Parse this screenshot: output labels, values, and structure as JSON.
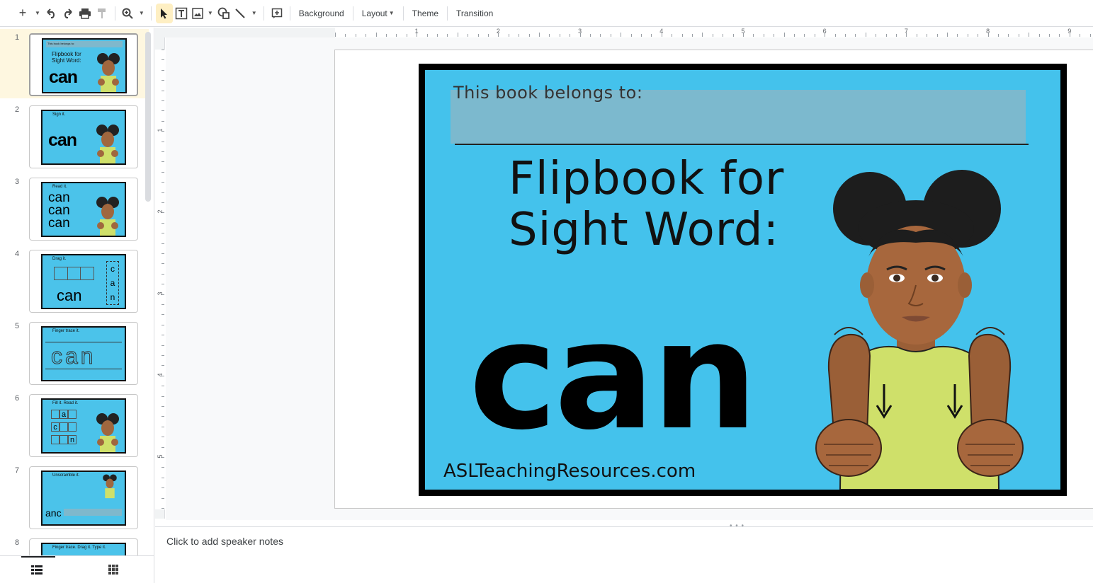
{
  "toolbar": {
    "items": {
      "background": "Background",
      "layout": "Layout",
      "theme": "Theme",
      "transition": "Transition"
    },
    "icons": [
      "plus-icon",
      "undo-icon",
      "redo-icon",
      "print-icon",
      "paint-format-icon",
      "zoom-icon",
      "select-icon",
      "text-box-icon",
      "image-icon",
      "shape-icon",
      "line-icon",
      "comment-icon"
    ]
  },
  "filmstrip": {
    "slides": [
      {
        "number": "1",
        "label": "This book belongs to:",
        "word": "can",
        "title": "Flipbook for Sight Word:"
      },
      {
        "number": "2",
        "label": "Sign it.",
        "word": "can"
      },
      {
        "number": "3",
        "label": "Read it.",
        "word": "can can can"
      },
      {
        "number": "4",
        "label": "Drag it.",
        "word": "can",
        "letters": [
          "c",
          "a",
          "n"
        ]
      },
      {
        "number": "5",
        "label": "Finger trace it.",
        "word": "can"
      },
      {
        "number": "6",
        "label": "Fill it. Read it.",
        "letters": [
          "a",
          "c",
          "n"
        ]
      },
      {
        "number": "7",
        "label": "Unscramble it.",
        "word": "anc"
      },
      {
        "number": "8",
        "label": "Finger trace. Drag it. Type it."
      }
    ],
    "footer_icons": [
      "filmstrip-view-icon",
      "grid-view-icon"
    ]
  },
  "ruler": {
    "top_numbers": [
      "1",
      "2",
      "3",
      "4",
      "5",
      "6",
      "7",
      "8",
      "9"
    ],
    "left_numbers": [
      "1",
      "2",
      "3",
      "4",
      "5"
    ]
  },
  "slide": {
    "belongs": "This book belongs to:",
    "title_line1": "Flipbook for",
    "title_line2": "Sight Word:",
    "word": "can",
    "website": "ASLTeachingResources.com",
    "colors": {
      "background": "#44c2ec",
      "frame": "#000000",
      "name_box": "#7fb8cc"
    }
  },
  "notes": {
    "placeholder": "Click to add speaker notes"
  }
}
